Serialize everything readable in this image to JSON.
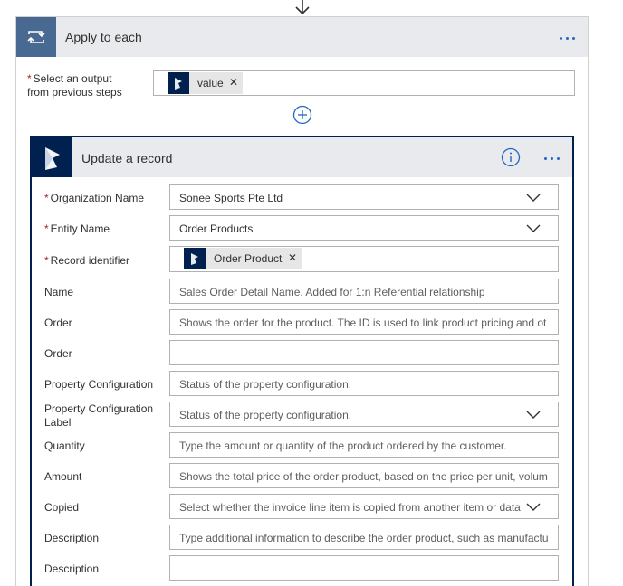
{
  "loop": {
    "title": "Apply to each",
    "output_label_line1": "Select an output",
    "output_label_line2": "from previous steps",
    "token_label": "value"
  },
  "action": {
    "title": "Update a record",
    "fields": {
      "org_label": "Organization Name",
      "org_value": "Sonee Sports Pte Ltd",
      "entity_label": "Entity Name",
      "entity_value": "Order Products",
      "record_label": "Record identifier",
      "record_token": "Order Product",
      "name_label": "Name",
      "name_placeholder": "Sales Order Detail Name. Added for 1:n Referential relationship",
      "order1_label": "Order",
      "order1_placeholder": "Shows the order for the product. The ID is used to link product pricing and ot",
      "order2_label": "Order",
      "order2_placeholder": "",
      "propconf_label": "Property Configuration",
      "propconf_placeholder": "Status of the property configuration.",
      "propconf_lbl_label1": "Property Configuration",
      "propconf_lbl_label2": "Label",
      "propconf_lbl_placeholder": "Status of the property configuration.",
      "quantity_label": "Quantity",
      "quantity_placeholder": "Type the amount or quantity of the product ordered by the customer.",
      "amount_label": "Amount",
      "amount_placeholder": "Shows the total price of the order product, based on the price per unit, volum",
      "copied_label": "Copied",
      "copied_placeholder": "Select whether the invoice line item is copied from another item or data",
      "desc1_label": "Description",
      "desc1_placeholder": "Type additional information to describe the order product, such as manufactu",
      "desc2_label": "Description",
      "desc2_placeholder": ""
    }
  },
  "required_mark": "*",
  "colors": {
    "loop_icon_bg": "#486991",
    "dynamics_bg": "#002050",
    "accent": "#2266c6",
    "required": "#a4262c"
  },
  "icons": [
    "down-arrow-icon",
    "loop-icon",
    "more-options-icon",
    "dynamics-icon",
    "close-icon",
    "add-step-icon",
    "info-icon",
    "chevron-down-icon"
  ]
}
